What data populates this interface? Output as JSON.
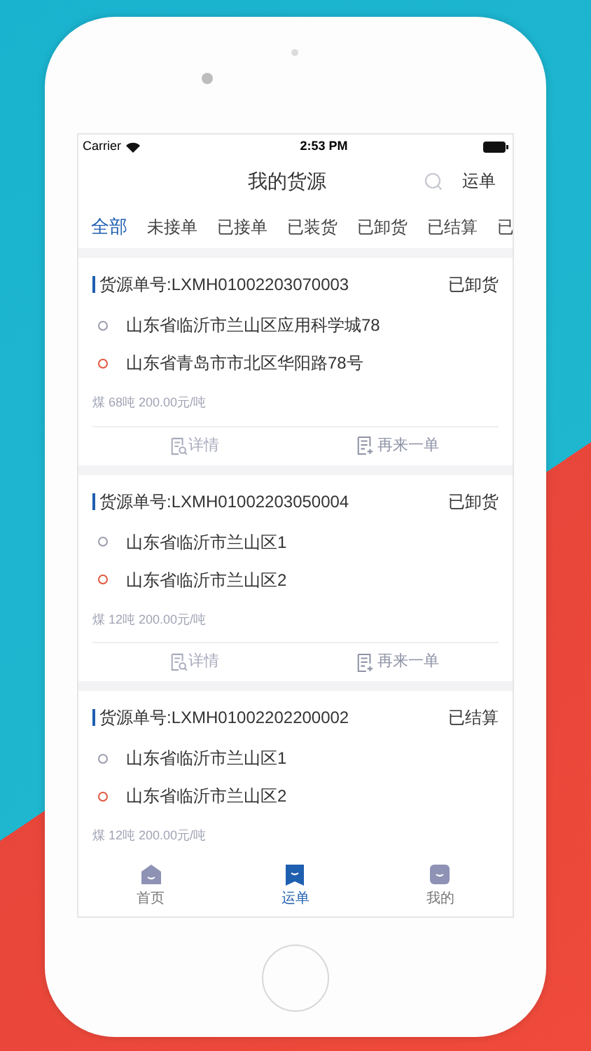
{
  "status_bar": {
    "carrier": "Carrier",
    "time": "2:53 PM"
  },
  "header": {
    "title": "我的货源",
    "action": "运单"
  },
  "tabs": [
    {
      "label": "全部",
      "selected": true
    },
    {
      "label": "未接单",
      "selected": false
    },
    {
      "label": "已接单",
      "selected": false
    },
    {
      "label": "已装货",
      "selected": false
    },
    {
      "label": "已卸货",
      "selected": false
    },
    {
      "label": "已结算",
      "selected": false
    },
    {
      "label": "已",
      "selected": false
    }
  ],
  "orders": [
    {
      "number": "货源单号:LXMH01002203070003",
      "status": "已卸货",
      "addresses": [
        {
          "text": "山东省临沂市兰山区应用科学城78",
          "color": "#9a9cae"
        },
        {
          "text": "山东省青岛市市北区华阳路78号",
          "color": "#e2573e"
        }
      ],
      "cargo": "煤 68吨 200.00元/吨",
      "actions": [
        {
          "kind": "details",
          "label": "详情"
        },
        {
          "kind": "reorder",
          "label": "再来一单"
        }
      ]
    },
    {
      "number": "货源单号:LXMH01002203050004",
      "status": "已卸货",
      "addresses": [
        {
          "text": "山东省临沂市兰山区1",
          "color": "#9a9cae"
        },
        {
          "text": "山东省临沂市兰山区2",
          "color": "#e2573e"
        }
      ],
      "cargo": "煤 12吨 200.00元/吨",
      "actions": [
        {
          "kind": "details",
          "label": "详情"
        },
        {
          "kind": "reorder",
          "label": "再来一单"
        }
      ]
    },
    {
      "number": "货源单号:LXMH01002202200002",
      "status": "已结算",
      "addresses": [
        {
          "text": "山东省临沂市兰山区1",
          "color": "#9a9cae"
        },
        {
          "text": "山东省临沂市兰山区2",
          "color": "#e2573e"
        }
      ],
      "cargo": "煤 12吨 200.00元/吨"
    }
  ],
  "tab_bar": [
    {
      "kind": "home",
      "label": "首页",
      "selected": false
    },
    {
      "kind": "waybill",
      "label": "运单",
      "selected": true
    },
    {
      "kind": "mine",
      "label": "我的",
      "selected": false
    }
  ]
}
